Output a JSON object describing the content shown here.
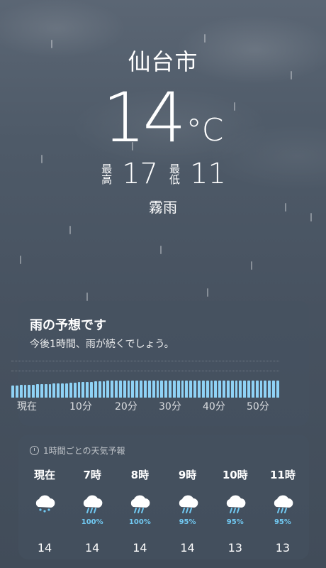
{
  "location": {
    "city": "仙台市",
    "temperature": "14",
    "unit": "°C",
    "high_label": "最高",
    "high": "17",
    "low_label": "最低",
    "low": "11",
    "condition": "霧雨"
  },
  "rain_card": {
    "title": "雨の予想です",
    "subtitle": "今後1時間、雨が続くでしょう。",
    "axis_labels": [
      "現在",
      "10分",
      "20分",
      "30分",
      "40分",
      "50分"
    ],
    "bar_color": "#8fd2f5",
    "intensity": [
      0.52,
      0.52,
      0.54,
      0.54,
      0.55,
      0.55,
      0.57,
      0.57,
      0.58,
      0.58,
      0.6,
      0.6,
      0.62,
      0.62,
      0.64,
      0.64,
      0.66,
      0.66,
      0.68,
      0.68,
      0.7,
      0.7,
      0.7,
      0.72,
      0.72,
      0.72,
      0.72,
      0.72,
      0.72,
      0.72,
      0.72,
      0.72,
      0.72,
      0.72,
      0.72,
      0.72,
      0.72,
      0.72,
      0.72,
      0.72,
      0.72,
      0.72,
      0.72,
      0.72,
      0.72,
      0.72,
      0.72,
      0.72,
      0.72,
      0.72,
      0.72,
      0.72,
      0.72,
      0.72,
      0.72,
      0.72,
      0.72,
      0.72,
      0.72,
      0.72,
      0.72,
      0.72,
      0.72,
      0.72,
      0.72
    ]
  },
  "hourly_card": {
    "title": "1時間ごとの天気予報",
    "pct_color": "#71c9f2",
    "hours": [
      {
        "label": "現在",
        "icon": "drizzle-cloud-icon",
        "pct": "",
        "temp": "14"
      },
      {
        "label": "7時",
        "icon": "rain-cloud-icon",
        "pct": "100%",
        "temp": "14"
      },
      {
        "label": "8時",
        "icon": "rain-cloud-icon",
        "pct": "100%",
        "temp": "14"
      },
      {
        "label": "9時",
        "icon": "rain-cloud-icon",
        "pct": "95%",
        "temp": "14"
      },
      {
        "label": "10時",
        "icon": "rain-cloud-icon",
        "pct": "95%",
        "temp": "13"
      },
      {
        "label": "11時",
        "icon": "rain-cloud-icon",
        "pct": "95%",
        "temp": "13"
      }
    ]
  }
}
